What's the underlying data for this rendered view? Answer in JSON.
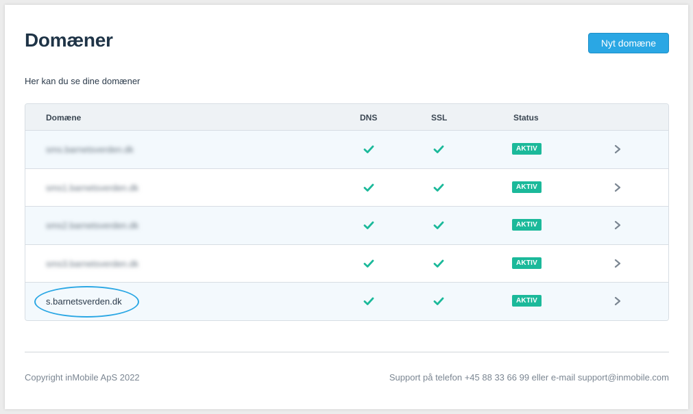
{
  "header": {
    "title": "Domæner",
    "new_button_label": "Nyt domæne",
    "subtitle": "Her kan du se dine domæner"
  },
  "table": {
    "columns": {
      "domain": "Domæne",
      "dns": "DNS",
      "ssl": "SSL",
      "status": "Status"
    },
    "rows": [
      {
        "domain": "sms.barnetsverden.dk",
        "blurred": true,
        "status": "AKTIV"
      },
      {
        "domain": "sms1.barnetsverden.dk",
        "blurred": true,
        "status": "AKTIV"
      },
      {
        "domain": "sms2.barnetsverden.dk",
        "blurred": true,
        "status": "AKTIV"
      },
      {
        "domain": "sms3.barnetsverden.dk",
        "blurred": true,
        "status": "AKTIV"
      },
      {
        "domain": "s.barnetsverden.dk",
        "blurred": false,
        "status": "AKTIV"
      }
    ]
  },
  "footer": {
    "copyright": "Copyright inMobile ApS 2022",
    "support": "Support på telefon +45 88 33 66 99 eller e-mail support@inmobile.com"
  },
  "icons": {
    "check": "check-icon",
    "chevron": "chevron-right-icon"
  },
  "colors": {
    "accent": "#2aa7e4",
    "status_active": "#1bb99a",
    "check": "#1bb99a"
  }
}
